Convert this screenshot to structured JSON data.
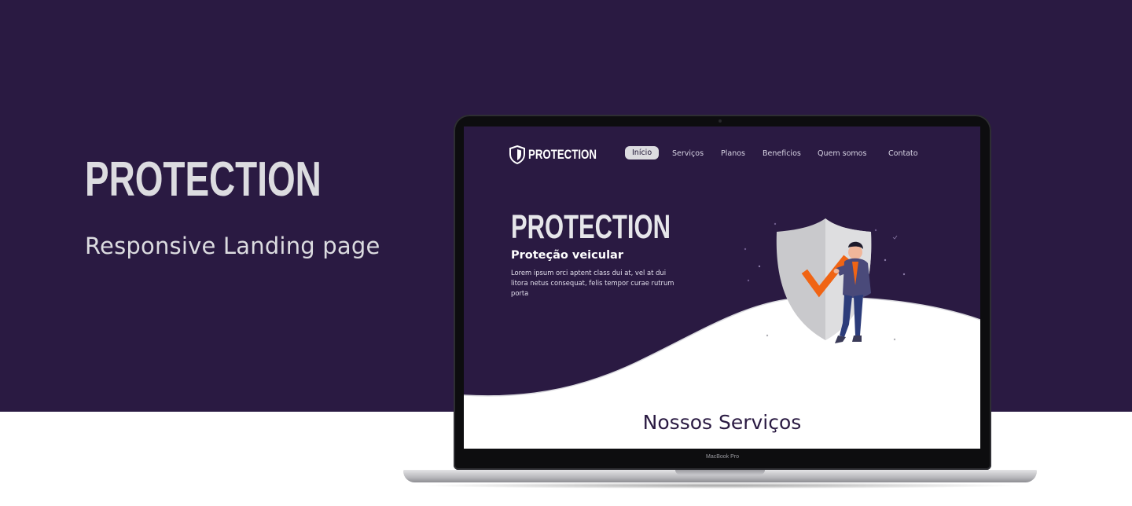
{
  "showcase": {
    "title": "PROTECTION",
    "subtitle": "Responsive Landing page"
  },
  "device": {
    "label": "MacBook Pro"
  },
  "site": {
    "logo_text": "PROTECTION",
    "nav": [
      {
        "label": "Início",
        "active": true
      },
      {
        "label": "Serviços",
        "active": false
      },
      {
        "label": "Planos",
        "active": false
      },
      {
        "label": "Beneficios",
        "active": false
      },
      {
        "label": "Quem somos",
        "active": false
      },
      {
        "label": "Contato",
        "active": false
      }
    ],
    "hero": {
      "title": "PROTECTION",
      "subtitle": "Proteção veicular",
      "description": "Lorem ipsum orci aptent class dui at, vel at dui litora netus consequat, felis tempor curae rutrum porta"
    },
    "section_title": "Nossos Serviços"
  },
  "colors": {
    "background_dark": "#2a1a42",
    "accent_orange": "#f06414",
    "text_light": "#dcdce0"
  },
  "icons": [
    "shield-logo-icon",
    "shield-checkmark-illustration"
  ]
}
